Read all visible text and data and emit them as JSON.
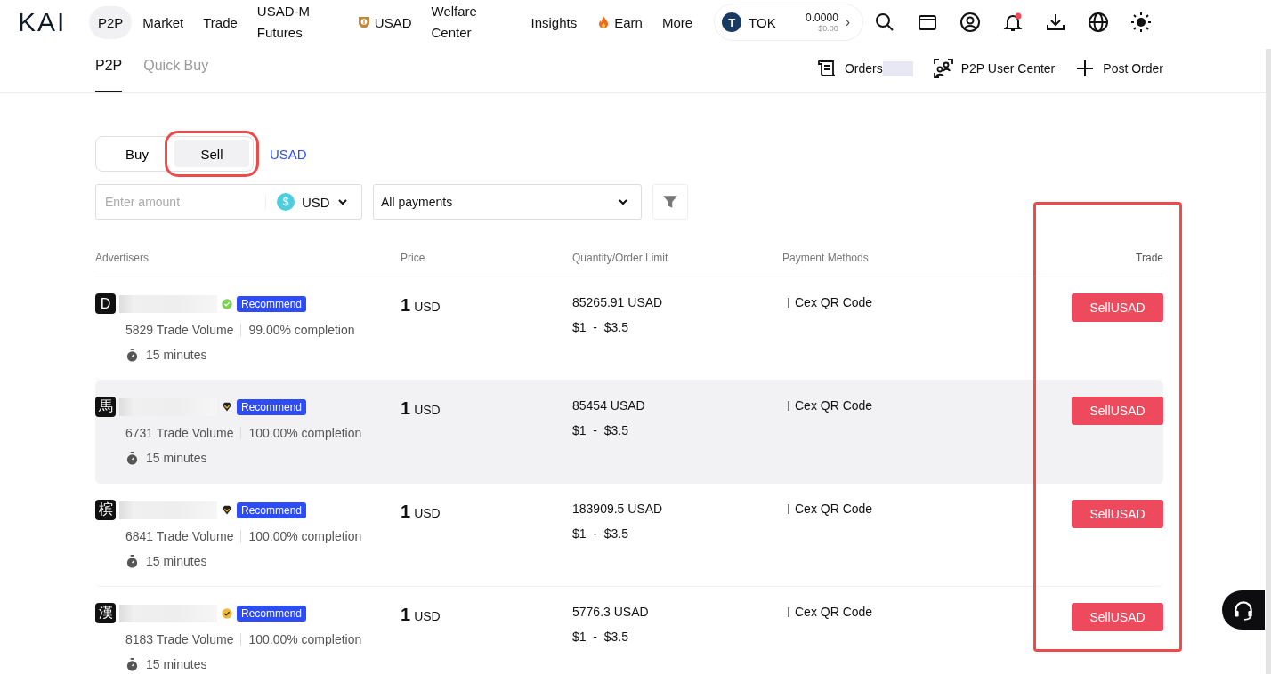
{
  "header": {
    "logo": "KAI",
    "nav": [
      {
        "label": "P2P",
        "selected": true,
        "kind": "plain"
      },
      {
        "label": "Market",
        "selected": false,
        "kind": "plain"
      },
      {
        "label": "Trade",
        "selected": false,
        "kind": "plain"
      },
      {
        "label": "USAD-M Futures",
        "selected": false,
        "kind": "wrap"
      },
      {
        "label": "USAD",
        "selected": false,
        "kind": "coin"
      },
      {
        "label": "Welfare Center",
        "selected": false,
        "kind": "wrap"
      },
      {
        "label": "Insights",
        "selected": false,
        "kind": "plain"
      },
      {
        "label": "Earn",
        "selected": false,
        "kind": "fire"
      },
      {
        "label": "More",
        "selected": false,
        "kind": "plain"
      }
    ],
    "token": {
      "icon_letter": "T",
      "symbol": "TOK",
      "amount": "0.0000",
      "value": "$0.00",
      "chevron": "›"
    },
    "notification_dot": true
  },
  "subnav": {
    "tabs": [
      {
        "label": "P2P",
        "selected": true
      },
      {
        "label": "Quick Buy",
        "selected": false
      }
    ],
    "actions": [
      {
        "label": "Orders",
        "kind": "orders"
      },
      {
        "label": "P2P User Center",
        "kind": "center"
      },
      {
        "label": "Post Order",
        "kind": "post"
      }
    ]
  },
  "side_tabs": [
    {
      "label": "Buy",
      "selected": false,
      "highlighted": false
    },
    {
      "label": "Sell",
      "selected": true,
      "highlighted": true
    }
  ],
  "asset": "USAD",
  "filters": {
    "amount_placeholder": "Enter amount",
    "currency": "USD",
    "currency_icon": "$",
    "payments": "All payments"
  },
  "columns": [
    {
      "label": "Advertisers",
      "highlighted": false
    },
    {
      "label": "Price",
      "highlighted": false
    },
    {
      "label": "Quantity/Order Limit",
      "highlighted": false
    },
    {
      "label": "Payment Methods",
      "highlighted": false
    },
    {
      "label": "Trade",
      "highlighted": true
    }
  ],
  "rows": [
    {
      "avatar": "D",
      "kind": "verified",
      "tag": "Recommend",
      "volume": "5829 Trade Volume",
      "completion": "99.00% completion",
      "time": "15 minutes",
      "price": "1",
      "price_unit": "USD",
      "quantity": "85265.91 USAD",
      "limit": "$1  -  $3.5",
      "payment": "Cex QR Code",
      "action": "SellUSAD",
      "hovered": false
    },
    {
      "avatar": "馬",
      "kind": "diamond",
      "tag": "Recommend",
      "volume": "6731 Trade Volume",
      "completion": "100.00% completion",
      "time": "15 minutes",
      "price": "1",
      "price_unit": "USD",
      "quantity": "85454 USAD",
      "limit": "$1  -  $3.5",
      "payment": "Cex QR Code",
      "action": "SellUSAD",
      "hovered": true
    },
    {
      "avatar": "槟",
      "kind": "diamond",
      "tag": "Recommend",
      "volume": "6841 Trade Volume",
      "completion": "100.00% completion",
      "time": "15 minutes",
      "price": "1",
      "price_unit": "USD",
      "quantity": "183909.5 USAD",
      "limit": "$1  -  $3.5",
      "payment": "Cex QR Code",
      "action": "SellUSAD",
      "hovered": false
    },
    {
      "avatar": "漢",
      "kind": "gold",
      "tag": "Recommend",
      "volume": "8183 Trade Volume",
      "completion": "100.00% completion",
      "time": "15 minutes",
      "price": "1",
      "price_unit": "USD",
      "quantity": "5776.3 USAD",
      "limit": "$1  -  $3.5",
      "payment": "Cex QR Code",
      "action": "SellUSAD",
      "hovered": false
    }
  ]
}
